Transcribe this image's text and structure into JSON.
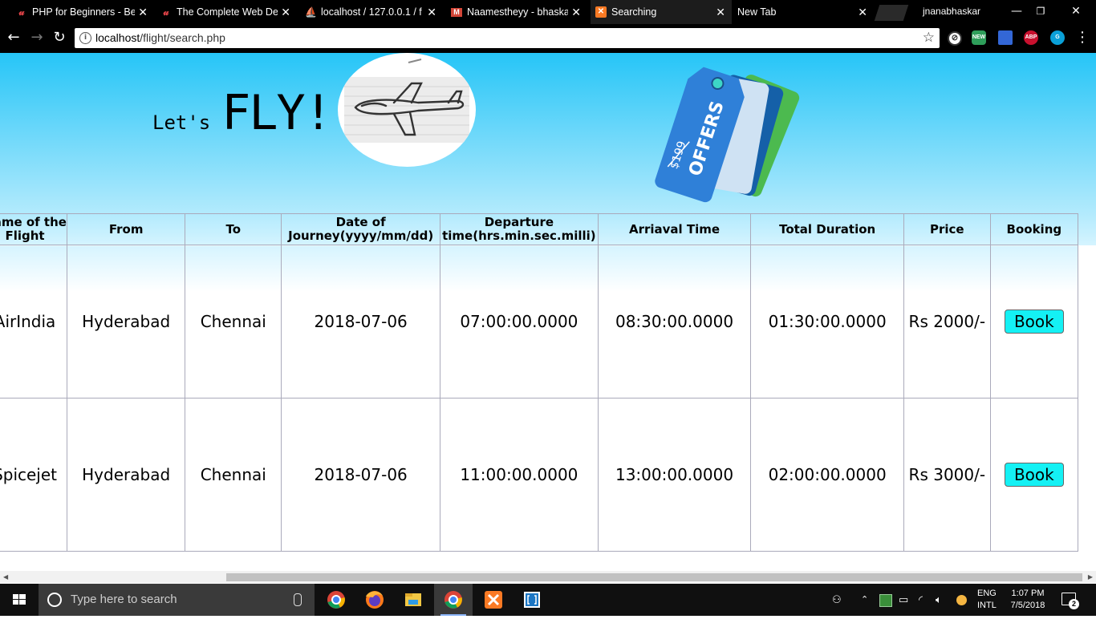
{
  "browser": {
    "tabs": [
      {
        "title": "PHP for Beginners - Be",
        "icon": "udemy-icon"
      },
      {
        "title": "The Complete Web De",
        "icon": "udemy-icon"
      },
      {
        "title": "localhost / 127.0.0.1 / f",
        "icon": "phpmyadmin-icon"
      },
      {
        "title": "Naamestheyy - bhaska",
        "icon": "gmail-icon"
      },
      {
        "title": "Searching",
        "icon": "xampp-icon",
        "active": true
      },
      {
        "title": "New Tab",
        "icon": ""
      }
    ],
    "user": "jnanabhaskar",
    "url_host": "localhost",
    "url_path": "/flight/search.php",
    "extensions": [
      "NEW",
      "ABP"
    ]
  },
  "page": {
    "lets": "Let's",
    "fly": "FLY!",
    "offers_tag": {
      "label": "OFFERS",
      "price": "$199"
    },
    "table": {
      "headers": [
        "Name of the Flight",
        "From",
        "To",
        "Date of Journey(yyyy/mm/dd)",
        "Departure time(hrs.min.sec.milli)",
        "Arriaval Time",
        "Total Duration",
        "Price",
        "Booking"
      ],
      "rows": [
        {
          "name": "AirIndia",
          "from": "Hyderabad",
          "to": "Chennai",
          "date": "2018-07-06",
          "departure": "07:00:00.0000",
          "arrival": "08:30:00.0000",
          "duration": "01:30:00.0000",
          "price": "Rs 2000/-",
          "book": "Book"
        },
        {
          "name": "Spicejet",
          "from": "Hyderabad",
          "to": "Chennai",
          "date": "2018-07-06",
          "departure": "11:00:00.0000",
          "arrival": "13:00:00.0000",
          "duration": "02:00:00.0000",
          "price": "Rs 3000/-",
          "book": "Book"
        }
      ]
    }
  },
  "taskbar": {
    "search_placeholder": "Type here to search",
    "lang_line1": "ENG",
    "lang_line2": "INTL",
    "time": "1:07 PM",
    "date": "7/5/2018",
    "notifications": "2"
  }
}
